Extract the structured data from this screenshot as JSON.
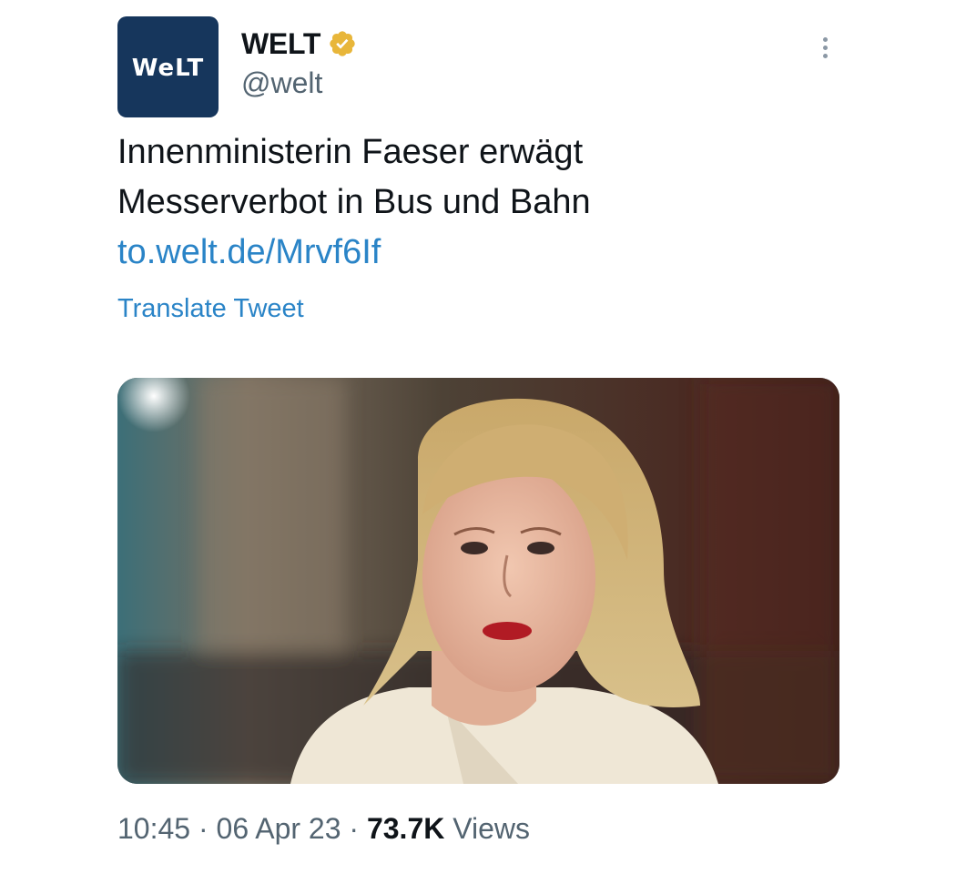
{
  "account": {
    "avatar_text": "WeLT",
    "display_name": "WELT",
    "handle": "@welt",
    "verified_icon": "verified-gold-badge-icon",
    "avatar_color": "#16365c",
    "badge_color": "#e8b63a"
  },
  "tweet": {
    "text_line_1": "Innenministerin Faeser erwägt",
    "text_line_2": "Messerverbot in Bus und Bahn",
    "link": "to.welt.de/Mrvf6If",
    "translate_label": "Translate Tweet"
  },
  "media": {
    "type": "photo"
  },
  "meta": {
    "time": "10:45",
    "separator": "·",
    "date": "06 Apr 23",
    "views_count": "73.7K",
    "views_label": "Views"
  },
  "colors": {
    "link": "#2a84c7",
    "text": "#0f1419",
    "secondary": "#536471"
  },
  "icons": {
    "more": "more-vertical-icon"
  }
}
